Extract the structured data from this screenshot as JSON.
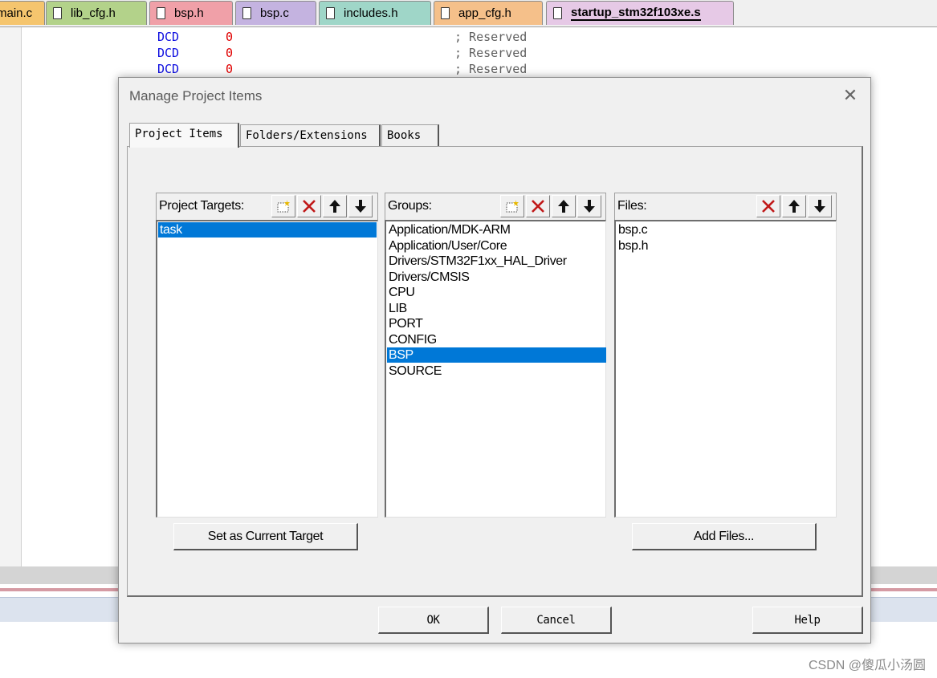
{
  "editor_tabs": [
    {
      "label": "main.c",
      "color": "#f5c56e"
    },
    {
      "label": "lib_cfg.h",
      "color": "#b3d28a"
    },
    {
      "label": "bsp.h",
      "color": "#f0a0a8"
    },
    {
      "label": "bsp.c",
      "color": "#c4b3e0"
    },
    {
      "label": "includes.h",
      "color": "#9fd6c8"
    },
    {
      "label": "app_cfg.h",
      "color": "#f5c08a"
    },
    {
      "label": "startup_stm32f103xe.s",
      "color": "#e6c9e6"
    }
  ],
  "code_lines": [
    {
      "op": "DCD",
      "val": "0",
      "comment": "; Reserved"
    },
    {
      "op": "DCD",
      "val": "0",
      "comment": "; Reserved"
    },
    {
      "op": "DCD",
      "val": "0",
      "comment": "; Reserved"
    }
  ],
  "dialog": {
    "title": "Manage Project Items",
    "tabs": [
      "Project Items",
      "Folders/Extensions",
      "Books"
    ],
    "targets": {
      "title": "Project Targets:",
      "items": [
        "task"
      ],
      "selected": 0
    },
    "groups": {
      "title": "Groups:",
      "items": [
        "Application/MDK-ARM",
        "Application/User/Core",
        "Drivers/STM32F1xx_HAL_Driver",
        "Drivers/CMSIS",
        "CPU",
        "LIB",
        "PORT",
        "CONFIG",
        "BSP",
        "SOURCE"
      ],
      "selected": 8
    },
    "files": {
      "title": "Files:",
      "items": [
        "bsp.c",
        "bsp.h"
      ]
    },
    "set_target_label": "Set as Current Target",
    "add_files_label": "Add Files...",
    "ok_label": "OK",
    "cancel_label": "Cancel",
    "help_label": "Help"
  },
  "watermark": "CSDN @傻瓜小汤圆",
  "colors": {
    "selection": "#0078d7",
    "delete_icon": "#c01818",
    "keyword": "#1010e0",
    "number": "#e00000"
  }
}
